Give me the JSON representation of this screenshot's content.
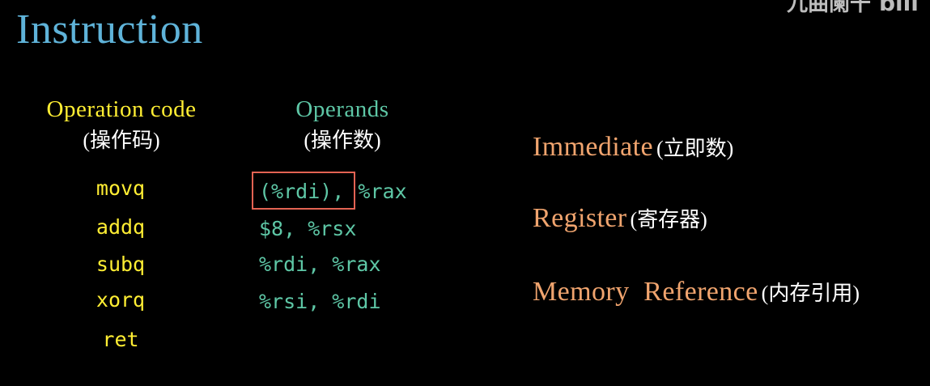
{
  "title": "Instruction",
  "watermark": {
    "text": "九曲阑干",
    "logo": "bili"
  },
  "colors": {
    "title": "#5fb3d9",
    "opcode": "#ffee33",
    "operand": "#5ec7a6",
    "operand_type": "#f0a46e",
    "highlight_box": "#e36353",
    "note": "#ffffff",
    "background": "#000000"
  },
  "opcode_column": {
    "header": "Operation code",
    "subheader": "(操作码)",
    "items": [
      "movq",
      "addq",
      "subq",
      "xorq",
      "ret"
    ]
  },
  "operand_column": {
    "header": "Operands",
    "subheader": "(操作数)",
    "rows": [
      {
        "highlighted": "(%rdi),",
        "rest": "%rax"
      },
      {
        "highlighted": "",
        "rest": "$8, %rsx"
      },
      {
        "highlighted": "",
        "rest": "%rdi, %rax"
      },
      {
        "highlighted": "",
        "rest": "%rsi, %rdi"
      }
    ]
  },
  "operand_types": [
    {
      "name": "Immediate",
      "note": "(立即数)"
    },
    {
      "name": "Register",
      "note": "(寄存器)"
    },
    {
      "name": "Memory  Reference",
      "note": "(内存引用)"
    }
  ]
}
